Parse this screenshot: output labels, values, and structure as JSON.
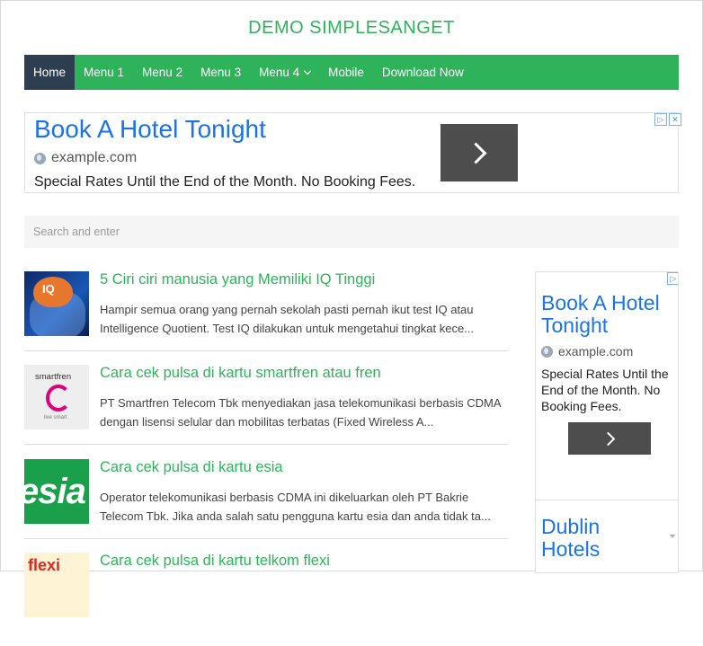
{
  "site": {
    "title": "DEMO SIMPLESANGET"
  },
  "nav": {
    "items": [
      {
        "label": "Home"
      },
      {
        "label": "Menu 1"
      },
      {
        "label": "Menu 2"
      },
      {
        "label": "Menu 3"
      },
      {
        "label": "Menu 4"
      },
      {
        "label": "Mobile"
      },
      {
        "label": "Download Now"
      }
    ],
    "active": "Home"
  },
  "ad_top": {
    "headline": "Book A Hotel Tonight",
    "url": "example.com",
    "description": "Special Rates Until the End of the Month. No Booking Fees.",
    "icons": [
      "globe-icon",
      "chevron-right-icon",
      "adchoices-icon",
      "close-icon"
    ]
  },
  "search": {
    "placeholder": "Search and enter"
  },
  "posts": [
    {
      "title": "5 Ciri ciri manusia yang Memiliki IQ Tinggi",
      "excerpt": "Hampir semua orang yang pernah sekolah pasti pernah ikut test IQ atau Intelligence Quotient. Test IQ dilakukan untuk mengetahui tingkat kece...",
      "thumb_text": "IQ"
    },
    {
      "title": "Cara cek pulsa di kartu smartfren atau fren",
      "excerpt": "PT Smartfren Telecom Tbk menyediakan jasa telekomunikasi berbasis CDMA dengan lisensi selular dan mobilitas terbatas (Fixed Wireless A...",
      "thumb_brand": "smartfren",
      "thumb_tag": "live smart"
    },
    {
      "title": "Cara cek pulsa di kartu esia",
      "excerpt": "Operator telekomunikasi berbasis CDMA ini dikeluarkan oleh PT Bakrie Telecom Tbk. Jika anda salah satu pengguna kartu esia dan anda tidak ta...",
      "thumb_text": "esia"
    },
    {
      "title": "Cara cek pulsa di kartu telkom flexi",
      "excerpt": "",
      "thumb_text": "flexi"
    }
  ],
  "ad_side": {
    "headline": "Book A Hotel Tonight",
    "url": "example.com",
    "description": "Special Rates Until the End of the Month. No Booking Fees.",
    "headline2": "Dublin Hotels"
  },
  "colors": {
    "accent": "#2eb35a",
    "nav_active": "#2c3e50",
    "ad_link": "#1a73e8",
    "ad_button": "#4d4d4d"
  }
}
